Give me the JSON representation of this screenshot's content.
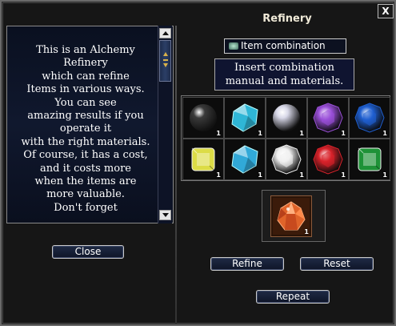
{
  "window": {
    "title": "Refinery",
    "close_label": "X"
  },
  "description": {
    "text": "This is an Alchemy\nRefinery\nwhich can refine\nItems in various ways.\nYou can see\namazing results if you\noperate it\nwith the right materials.\nOf course, it has a cost,\nand it costs more\nwhen the items are\nmore valuable.\nDon't forget"
  },
  "buttons": {
    "close": "Close",
    "refine": "Refine",
    "reset": "Reset",
    "repeat": "Repeat"
  },
  "combination": {
    "label": "Item combination",
    "instruction": "Insert combination\nmanual and materials."
  },
  "materials": [
    {
      "name": "black-pearl-icon",
      "color": "#3a3a3a",
      "count": "1"
    },
    {
      "name": "aquamarine-icon",
      "color": "#2fb6d6",
      "count": "1"
    },
    {
      "name": "white-pearl-icon",
      "color": "#d8d8e8",
      "count": "1"
    },
    {
      "name": "amethyst-icon",
      "color": "#9a4fd8",
      "count": "1"
    },
    {
      "name": "sapphire-icon",
      "color": "#1f5fd0",
      "count": "1"
    },
    {
      "name": "yellow-gem-icon",
      "color": "#e8e84a",
      "count": "1"
    },
    {
      "name": "blue-topaz-icon",
      "color": "#31a9d8",
      "count": "1"
    },
    {
      "name": "diamond-icon",
      "color": "#f0f0f0",
      "count": "1"
    },
    {
      "name": "ruby-icon",
      "color": "#d8222a",
      "count": "1"
    },
    {
      "name": "emerald-icon",
      "color": "#1f9a3a",
      "count": "1"
    }
  ],
  "result": {
    "name": "refined-crystal-icon",
    "color": "#e0642a",
    "count": "1"
  }
}
